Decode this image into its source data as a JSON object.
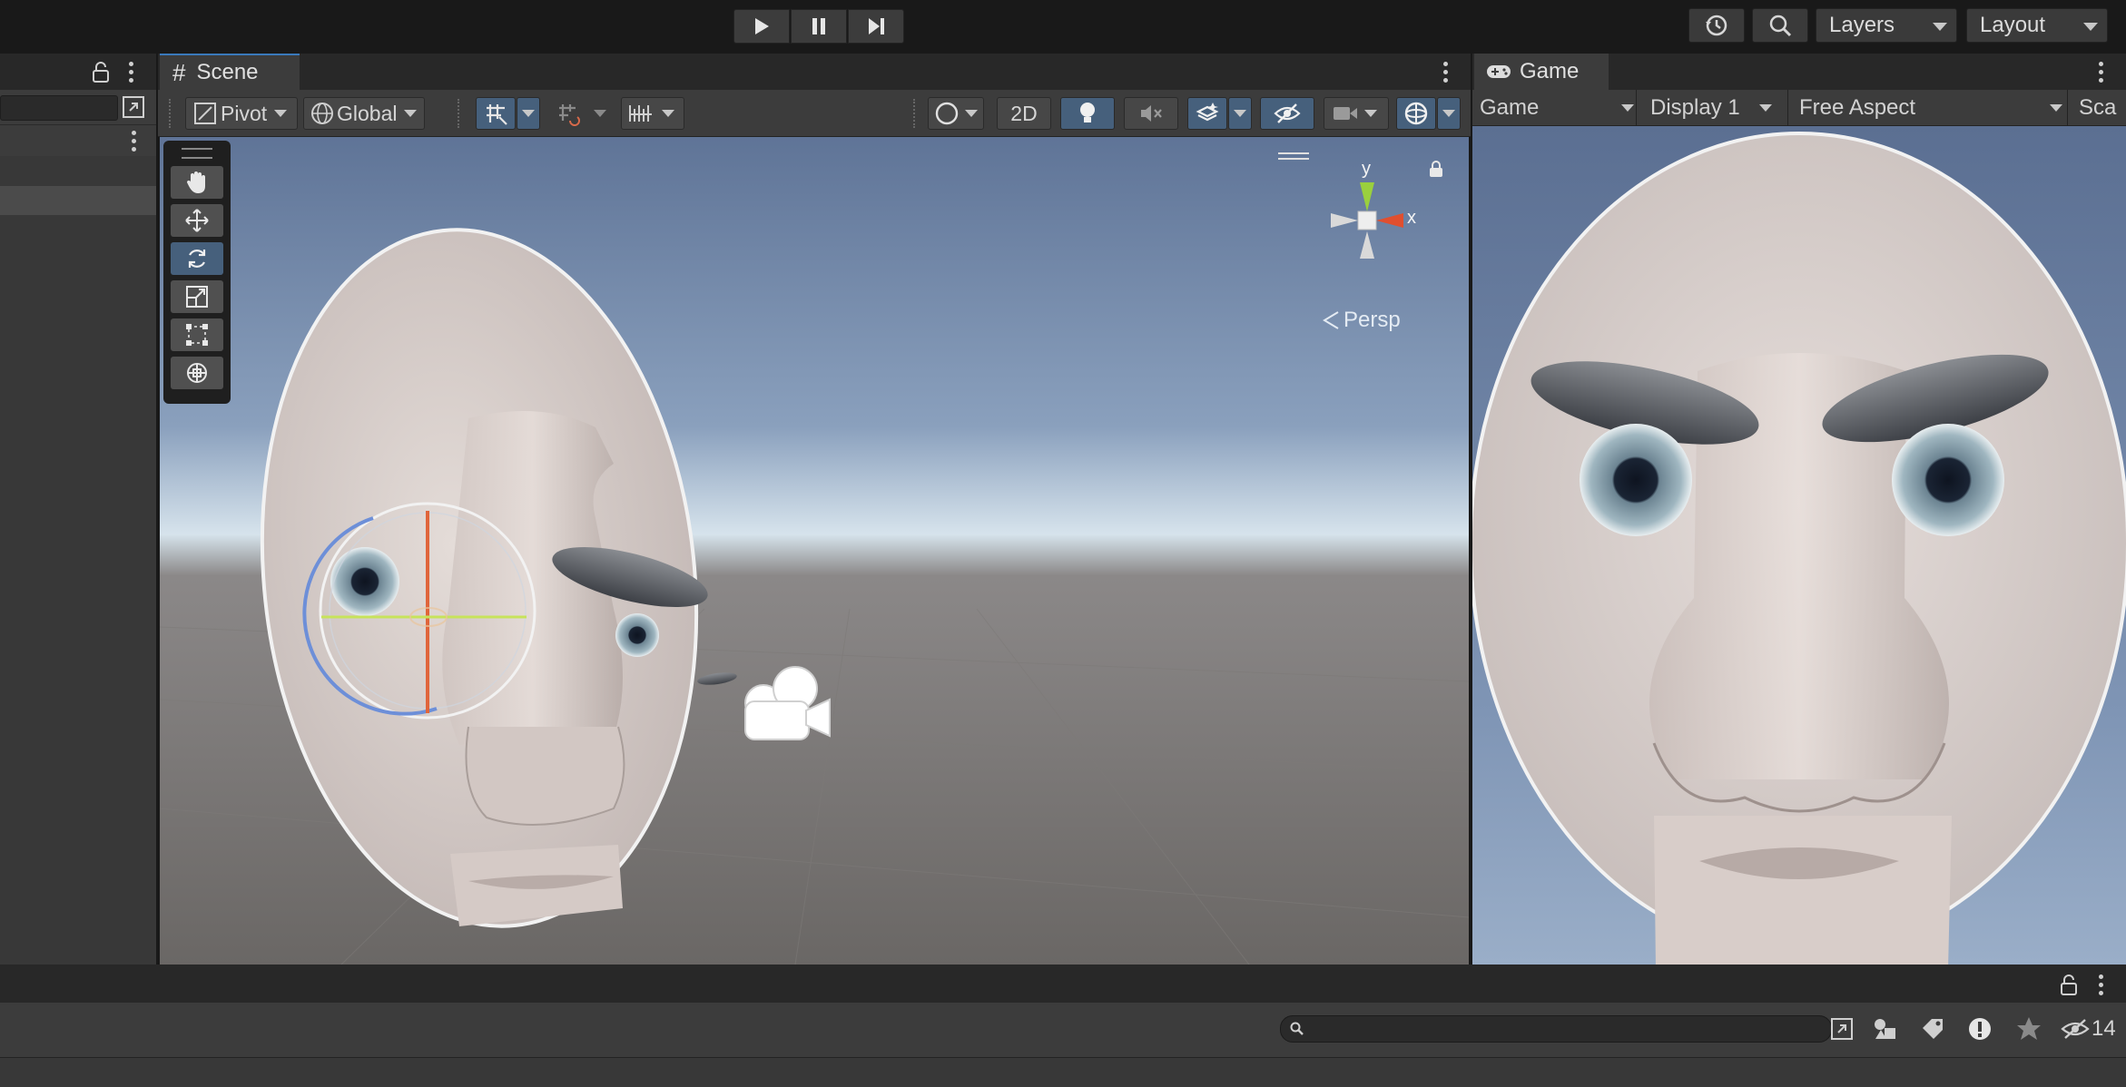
{
  "toolbar_top": {
    "play_icon": "play-icon",
    "pause_icon": "pause-icon",
    "step_icon": "step-icon",
    "history_icon": "history-icon",
    "search_icon": "search-icon",
    "layers_label": "Layers",
    "layout_label": "Layout"
  },
  "scene": {
    "tab_label": "Scene",
    "pivot_label": "Pivot",
    "global_label": "Global",
    "mode_2d_label": "2D",
    "persp_label": "Persp",
    "axis_y": "y",
    "axis_x": "x"
  },
  "game": {
    "tab_label": "Game",
    "game_dropdown": "Game",
    "display_dropdown": "Display 1",
    "aspect_dropdown": "Free Aspect",
    "scale_label": "Sca"
  },
  "bottom": {
    "search_placeholder": "",
    "hidden_count": "14"
  },
  "colors": {
    "accent": "#46607c",
    "panel_bg": "#3c3c3c",
    "dark_bg": "#191919"
  }
}
